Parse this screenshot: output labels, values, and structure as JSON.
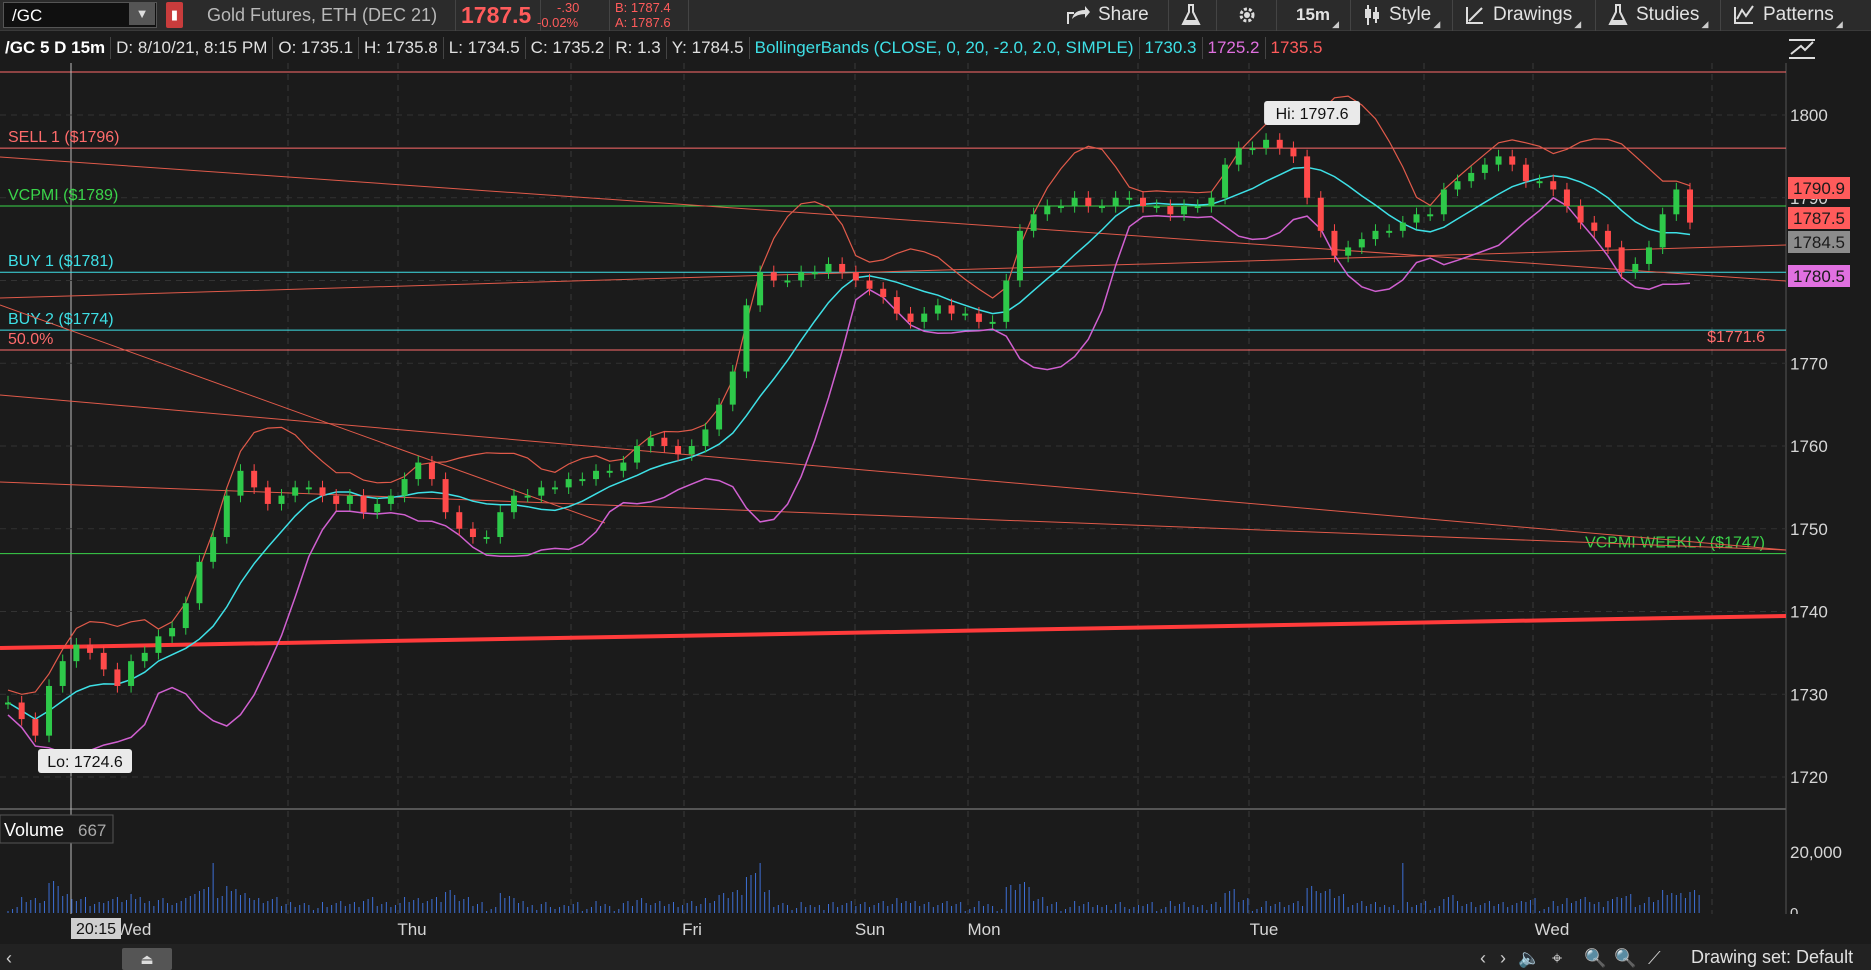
{
  "toolbar": {
    "symbol": "/GC",
    "instrument": "Gold Futures, ETH (DEC 21)",
    "last_price": "1787.5",
    "change": "-.30",
    "change_pct": "-0.02%",
    "bid": "B: 1787.4",
    "ask": "A: 1787.6",
    "share_label": "Share",
    "timeframe_label": "15m",
    "style_label": "Style",
    "drawings_label": "Drawings",
    "studies_label": "Studies",
    "patterns_label": "Patterns"
  },
  "infobar": {
    "symbol_period": "/GC 5 D 15m",
    "date": "D: 8/10/21, 8:15 PM",
    "open": "O: 1735.1",
    "high": "H: 1735.8",
    "low": "L: 1734.5",
    "close": "C: 1735.2",
    "range": "R: 1.3",
    "y": "Y: 1784.5",
    "study": "BollingerBands (CLOSE, 0, 20, -2.0, 2.0, SIMPLE)",
    "bb_mid": "1730.3",
    "bb_lower": "1725.2",
    "bb_upper": "1735.5"
  },
  "chart_data": {
    "type": "candlestick",
    "y_axis": {
      "min": 1716,
      "max": 1805,
      "ticks": [
        1720,
        1730,
        1740,
        1750,
        1760,
        1770,
        1780,
        1790,
        1800
      ]
    },
    "x_labels": [
      "Wed",
      "Thu",
      "Fri",
      "Sun",
      "Mon",
      "Tue",
      "Wed"
    ],
    "crosshair_time": "20:15",
    "hi_label": "Hi: 1797.6",
    "lo_label": "Lo: 1724.6",
    "levels": [
      {
        "label": "SELL 1 ($1796)",
        "value": 1796,
        "color": "#ff6b6b"
      },
      {
        "label": "VCPMI  ($1789)",
        "value": 1789,
        "color": "#3ad44a"
      },
      {
        "label": "BUY 1 ($1781)",
        "value": 1781,
        "color": "#3ee0e6"
      },
      {
        "label": "BUY 2 ($1774)",
        "value": 1774,
        "color": "#3ee0e6"
      },
      {
        "label": "50.0%",
        "value": 1771.6,
        "color": "#ff6b6b"
      },
      {
        "label": "VCPMI WEEKLY ($1747)",
        "value": 1747,
        "color": "#3ad44a"
      }
    ],
    "fib_label": "$1771.6",
    "price_badges": [
      {
        "value": "1790.9",
        "bg": "#ff5b5b",
        "fg": "#1b1b1b"
      },
      {
        "value": "1787.5",
        "bg": "#ff5b5b",
        "fg": "#1b1b1b"
      },
      {
        "value": "1784.5",
        "bg": "#8c8c8c",
        "fg": "#1b1b1b"
      },
      {
        "value": "1780.5",
        "bg": "#e070e0",
        "fg": "#1b1b1b"
      }
    ],
    "close_series": [
      1729,
      1727,
      1725,
      1731,
      1734,
      1736,
      1735,
      1733,
      1731,
      1734,
      1735,
      1737,
      1738,
      1741,
      1746,
      1749,
      1754,
      1757,
      1755,
      1753,
      1754,
      1755,
      1755,
      1754,
      1753,
      1754,
      1752,
      1753,
      1754,
      1756,
      1758,
      1756,
      1752,
      1750,
      1749,
      1749,
      1752,
      1754,
      1754,
      1755,
      1755,
      1756,
      1756,
      1757,
      1757,
      1758,
      1760,
      1761,
      1760,
      1759,
      1760,
      1762,
      1765,
      1769,
      1777,
      1781,
      1780,
      1780,
      1781,
      1781,
      1782,
      1781,
      1780,
      1779,
      1778,
      1776,
      1775,
      1776,
      1777,
      1776,
      1776,
      1775,
      1775,
      1780,
      1786,
      1788,
      1789,
      1789,
      1790,
      1789,
      1789,
      1790,
      1790,
      1789,
      1789,
      1788,
      1789,
      1789,
      1790,
      1794,
      1796,
      1796,
      1797,
      1796,
      1795,
      1790,
      1786,
      1783,
      1784,
      1785,
      1786,
      1786,
      1787,
      1788,
      1788,
      1791,
      1792,
      1793,
      1794,
      1795,
      1794,
      1792,
      1792,
      1791,
      1789,
      1787,
      1786,
      1784,
      1781,
      1782,
      1784,
      1788,
      1791,
      1787
    ],
    "volume": {
      "label": "Volume",
      "value": "667",
      "axis_max": "20,000",
      "axis_min": "0"
    }
  },
  "bottombar": {
    "drawing_set": "Drawing set: Default"
  }
}
